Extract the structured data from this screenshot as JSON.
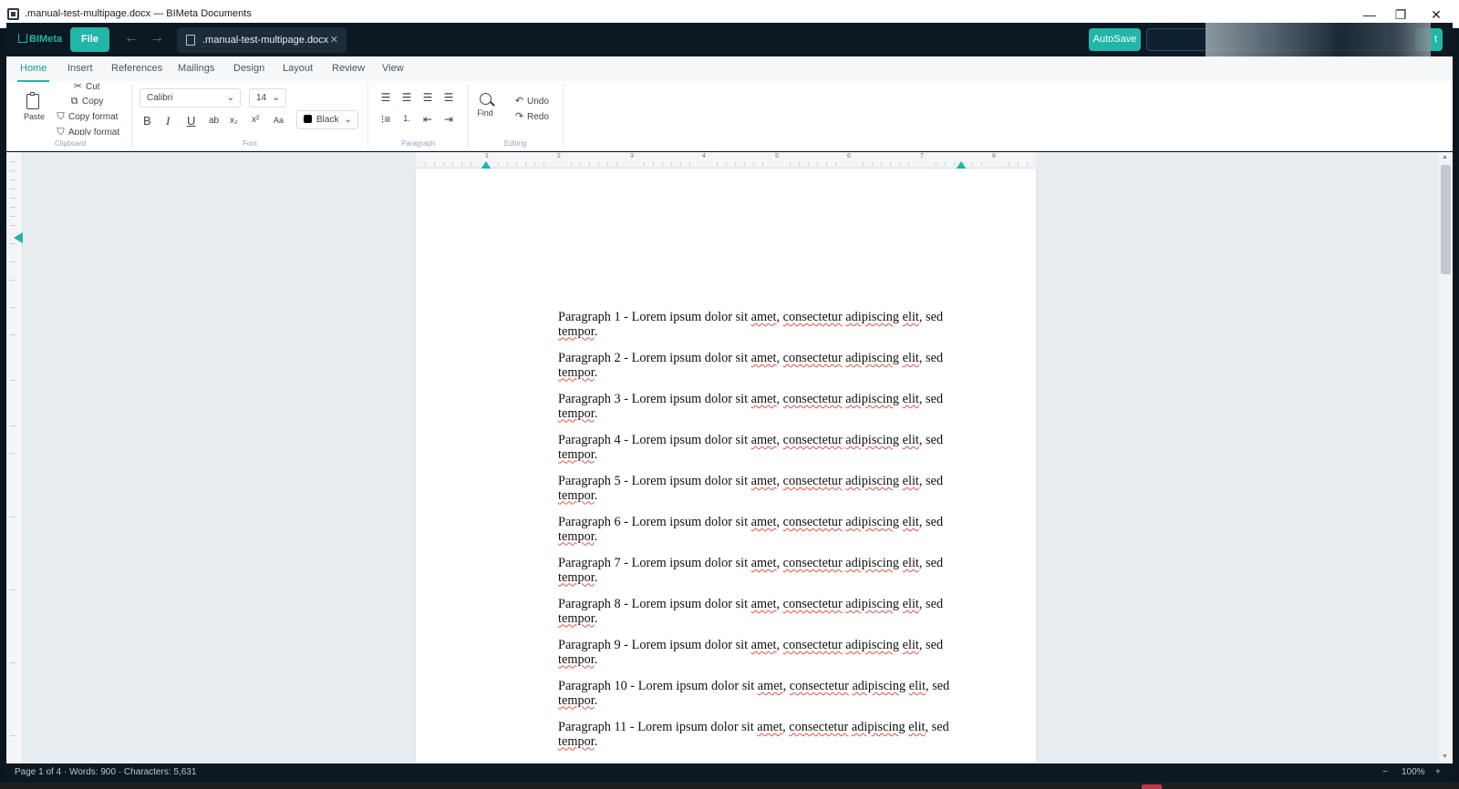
{
  "window": {
    "title": ".manual-test-multipage.docx — BIMeta Documents",
    "controls": {
      "minimize": "—",
      "maximize": "❐",
      "close": "✕"
    }
  },
  "header": {
    "logo": "BIMeta",
    "file_button": "File",
    "back_icon": "←",
    "forward_icon": "→",
    "doc_tab": {
      "name": ".manual-test-multipage.docx",
      "close": "✕"
    },
    "autosave_button": "AutoSave",
    "share_button_partial": "t"
  },
  "ribbon": {
    "tabs": [
      {
        "label": "Home",
        "active": true
      },
      {
        "label": "Insert"
      },
      {
        "label": "References"
      },
      {
        "label": "Mailings"
      },
      {
        "label": "Design"
      },
      {
        "label": "Layout"
      },
      {
        "label": "Review"
      },
      {
        "label": "View"
      }
    ],
    "clipboard": {
      "group_label": "Clipboard",
      "paste": "Paste",
      "cut": "Cut",
      "copy": "Copy",
      "copy_format": "Copy format",
      "apply_format": "Apply format"
    },
    "font": {
      "group_label": "Font",
      "family": "Calibri",
      "size": "14",
      "bold": "B",
      "italic": "I",
      "underline": "U",
      "strike": "ab",
      "subscript": "x₂",
      "superscript": "x²",
      "change_case": "Aa",
      "color": "Black",
      "color_hex": "#000000"
    },
    "paragraph": {
      "group_label": "Paragraph",
      "numbered_list": "1."
    },
    "editing": {
      "group_label": "Editing",
      "find": "Find",
      "undo": "Undo",
      "redo": "Redo"
    }
  },
  "ruler": {
    "numbers": [
      "1",
      "2",
      "3",
      "4",
      "5",
      "6",
      "7",
      "8"
    ]
  },
  "document": {
    "paragraphs": [
      {
        "label": "Paragraph 1"
      },
      {
        "label": "Paragraph 2"
      },
      {
        "label": "Paragraph 3"
      },
      {
        "label": "Paragraph 4"
      },
      {
        "label": "Paragraph 5"
      },
      {
        "label": "Paragraph 6"
      },
      {
        "label": "Paragraph 7"
      },
      {
        "label": "Paragraph 8"
      },
      {
        "label": "Paragraph 9"
      },
      {
        "label": "Paragraph 10"
      },
      {
        "label": "Paragraph 11"
      }
    ],
    "text_before": " - Lorem ipsum dolor sit ",
    "word_amet": "amet",
    "comma": ",",
    "word_consectetur": "consectetur",
    "word_adipiscing": "adipiscing",
    "word_elit": "elit",
    "tail": ", sed",
    "word_tempor": "tempor",
    "period": "."
  },
  "status": {
    "page": "Page 1 of 4",
    "words": "Words: 900",
    "characters": "Characters: 5,631",
    "separator": "·",
    "zoom_out": "−",
    "zoom": "100%",
    "zoom_in": "+"
  },
  "colors": {
    "accent": "#21b6a8",
    "dark": "#0c1822",
    "spell_error": "#e0524a"
  }
}
